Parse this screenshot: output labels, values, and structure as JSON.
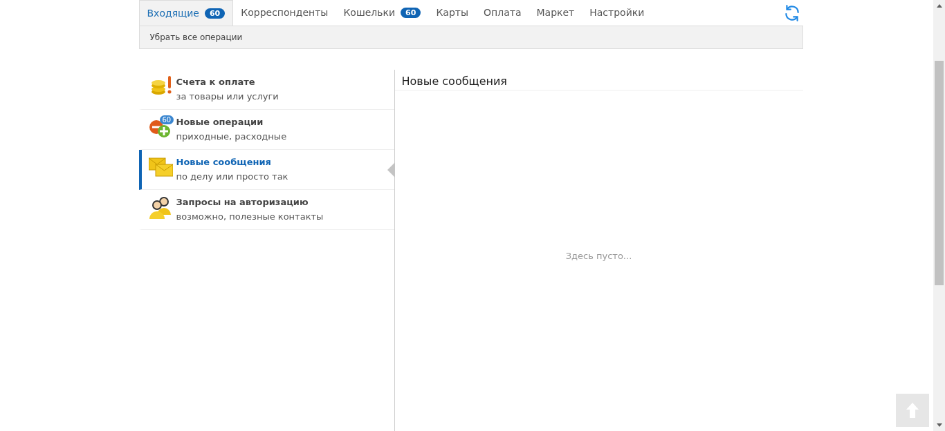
{
  "tabs": [
    {
      "label": "Входящие",
      "badge": "60",
      "selected": true
    },
    {
      "label": "Корреспонденты",
      "selected": false
    },
    {
      "label": "Кошельки",
      "badge": "60",
      "selected": false
    },
    {
      "label": "Карты",
      "selected": false
    },
    {
      "label": "Оплата",
      "selected": false
    },
    {
      "label": "Маркет",
      "selected": false
    },
    {
      "label": "Настройки",
      "selected": false
    }
  ],
  "toolbar": {
    "action": "Убрать все операции"
  },
  "sidebar": {
    "items": [
      {
        "title": "Счета к оплате",
        "subtitle": "за товары или услуги",
        "selected": false
      },
      {
        "title": "Новые операции",
        "subtitle": "приходные, расходные",
        "badge": "60",
        "selected": false
      },
      {
        "title": "Новые сообщения",
        "subtitle": "по делу или просто так",
        "selected": true
      },
      {
        "title": "Запросы на авторизацию",
        "subtitle": "возможно, полезные контакты",
        "selected": false
      }
    ]
  },
  "panel": {
    "title": "Новые сообщения",
    "empty_text": "Здесь пусто..."
  }
}
